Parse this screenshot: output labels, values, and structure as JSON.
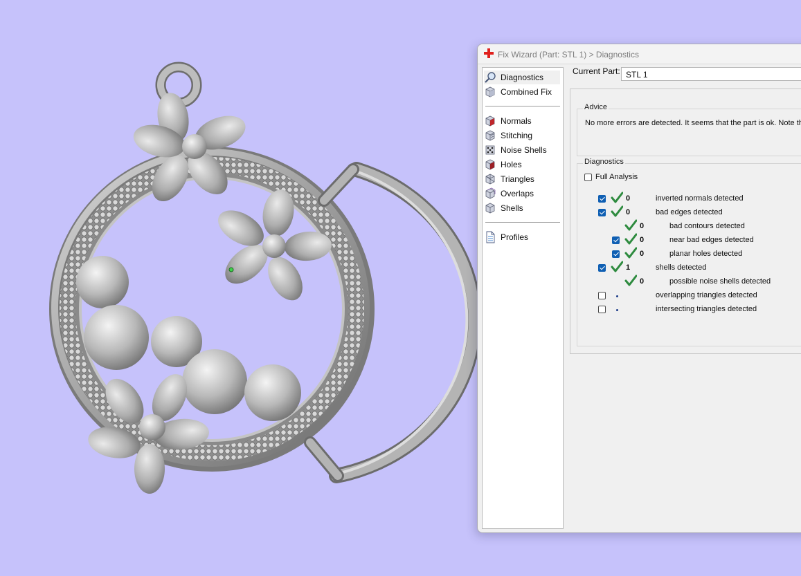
{
  "window": {
    "title": "Fix Wizard (Part: STL 1) > Diagnostics"
  },
  "nav": {
    "groups": [
      [
        {
          "label": "Diagnostics",
          "icon": "magnifier-icon",
          "selected": true
        },
        {
          "label": "Combined Fix",
          "icon": "combined-fix-icon",
          "selected": false
        }
      ],
      [
        {
          "label": "Normals",
          "icon": "normals-cube-icon",
          "selected": false
        },
        {
          "label": "Stitching",
          "icon": "stitching-cube-icon",
          "selected": false
        },
        {
          "label": "Noise Shells",
          "icon": "noise-shells-icon",
          "selected": false
        },
        {
          "label": "Holes",
          "icon": "holes-cube-icon",
          "selected": false
        },
        {
          "label": "Triangles",
          "icon": "triangles-cube-icon",
          "selected": false
        },
        {
          "label": "Overlaps",
          "icon": "overlaps-cube-icon",
          "selected": false
        },
        {
          "label": "Shells",
          "icon": "shells-cube-icon",
          "selected": false
        }
      ],
      [
        {
          "label": "Profiles",
          "icon": "profiles-document-icon",
          "selected": false
        }
      ]
    ]
  },
  "current_part": {
    "label": "Current Part:",
    "value": "STL 1"
  },
  "advice": {
    "title": "Advice",
    "text": "No more errors are detected. It seems that the part is ok. Note th"
  },
  "diagnostics": {
    "title": "Diagnostics",
    "full_analysis": {
      "label": "Full Analysis",
      "checked": false
    },
    "rows": [
      {
        "indent": 0,
        "checkbox": true,
        "checked": true,
        "status": "ok",
        "count": "0",
        "label": "inverted normals detected"
      },
      {
        "indent": 0,
        "checkbox": true,
        "checked": true,
        "status": "ok",
        "count": "0",
        "label": "bad edges detected"
      },
      {
        "indent": 1,
        "checkbox": false,
        "checked": false,
        "status": "ok",
        "count": "0",
        "label": "bad contours detected"
      },
      {
        "indent": 1,
        "checkbox": true,
        "checked": true,
        "status": "ok",
        "count": "0",
        "label": "near bad edges detected"
      },
      {
        "indent": 1,
        "checkbox": true,
        "checked": true,
        "status": "ok",
        "count": "0",
        "label": "planar holes detected"
      },
      {
        "indent": 0,
        "checkbox": true,
        "checked": true,
        "status": "ok",
        "count": "1",
        "label": "shells detected"
      },
      {
        "indent": 1,
        "checkbox": false,
        "checked": false,
        "status": "ok",
        "count": "0",
        "label": "possible noise shells detected"
      },
      {
        "indent": 0,
        "checkbox": true,
        "checked": false,
        "status": "pending",
        "count": "",
        "label": "overlapping triangles detected"
      },
      {
        "indent": 0,
        "checkbox": true,
        "checked": false,
        "status": "pending",
        "count": "",
        "label": "intersecting triangles detected"
      }
    ]
  },
  "colors": {
    "background": "#c6c2fb",
    "model": "#a9a9a9",
    "check_green": "#2e8b3f",
    "checkbox_blue": "#0f5fb3"
  }
}
